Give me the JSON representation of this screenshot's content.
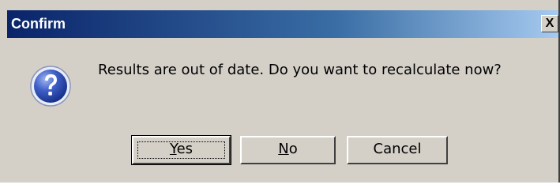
{
  "dialog": {
    "title": "Confirm",
    "close_label": "X",
    "message": "Results are out of date.  Do you want to recalculate now?",
    "icon": "question-icon"
  },
  "buttons": {
    "yes": {
      "mnemonic": "Y",
      "rest": "es"
    },
    "no": {
      "mnemonic": "N",
      "rest": "o"
    },
    "cancel": {
      "label": "Cancel"
    }
  },
  "colors": {
    "title_start": "#0a246a",
    "title_end": "#a6caf0",
    "face": "#d4d0c8"
  }
}
